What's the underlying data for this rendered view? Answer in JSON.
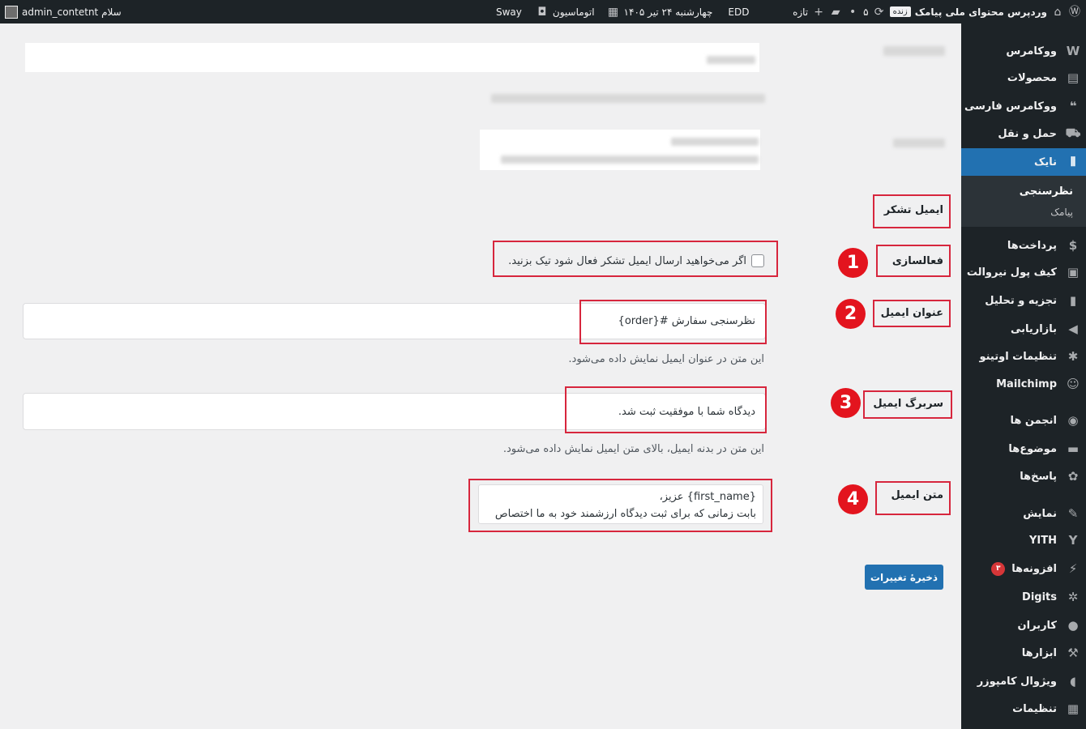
{
  "admin_bar": {
    "site_name": "وردپرس محتوای ملی پیامک",
    "live_badge": "زنده",
    "updates_count": "۵",
    "new_label": "تازه",
    "sway": "Sway",
    "automation": "اتوماسیون",
    "date": "چهارشنبه ۲۴ تیر ۱۴۰۵",
    "edd": "EDD",
    "greeting": "سلام admin_contetnt"
  },
  "sidebar": {
    "items": [
      {
        "label": "ووکامرس",
        "icon": "woocommerce-icon"
      },
      {
        "label": "محصولات",
        "icon": "products-icon"
      },
      {
        "label": "ووکامرس فارسی",
        "icon": "persian-woo-icon"
      },
      {
        "label": "حمل و نقل",
        "icon": "truck-icon"
      },
      {
        "label": "نایک",
        "icon": "nike-icon"
      },
      {
        "label": "پرداخت‌ها",
        "icon": "payments-icon"
      },
      {
        "label": "کیف پول نیروالت",
        "icon": "wallet-icon"
      },
      {
        "label": "تجزیه و تحلیل",
        "icon": "analytics-icon"
      },
      {
        "label": "بازاریابی",
        "icon": "megaphone-icon"
      },
      {
        "label": "تنظیمات اوتینو",
        "icon": "asterisk-icon"
      },
      {
        "label": "Mailchimp",
        "icon": "mailchimp-icon"
      },
      {
        "label": "انجمن ها",
        "icon": "forums-icon"
      },
      {
        "label": "موضوع‌ها",
        "icon": "topics-icon"
      },
      {
        "label": "پاسخ‌ها",
        "icon": "replies-icon"
      },
      {
        "label": "نمایش",
        "icon": "appearance-icon"
      },
      {
        "label": "YITH",
        "icon": "yith-icon"
      },
      {
        "label": "افزونه‌ها",
        "icon": "plugins-icon",
        "badge": "۳"
      },
      {
        "label": "Digits",
        "icon": "digits-icon"
      },
      {
        "label": "کاربران",
        "icon": "users-icon"
      },
      {
        "label": "ابزارها",
        "icon": "tools-icon"
      },
      {
        "label": "ویژوال کامپوزر",
        "icon": "composer-icon"
      },
      {
        "label": "تنظیمات",
        "icon": "settings-icon"
      }
    ],
    "submenu": [
      {
        "label": "نظرسنجی"
      },
      {
        "label": "پیامک"
      }
    ]
  },
  "form": {
    "section_title": "ایمیل تشکر",
    "activation_label": "فعالسازی",
    "activation_checkbox_text": "اگر می‌خواهید ارسال ایمیل تشکر فعال شود تیک بزنید.",
    "subject_label": "عنوان ایمیل",
    "subject_value": "نظرسنجی سفارش #{order}",
    "subject_desc": "این متن در عنوان ایمیل نمایش داده می‌شود.",
    "header_label": "سربرگ ایمیل",
    "header_value": "دیدگاه شما با موفقیت ثبت شد.",
    "header_desc": "این متن در بدنه ایمیل، بالای متن ایمیل نمایش داده می‌شود.",
    "body_label": "متن ایمیل",
    "body_line1": "{first_name} عزیز،",
    "body_line2": "بابت زمانی که برای ثبت دیدگاه ارزشمند خود به ما اختصاص",
    "save_button": "ذخیرهٔ تغییرات"
  },
  "annotations": [
    "1",
    "2",
    "3",
    "4"
  ],
  "colors": {
    "admin_bar_bg": "#1d2327",
    "accent": "#2271b1",
    "highlight_red": "#d7263d",
    "badge_red": "#e3141e"
  }
}
